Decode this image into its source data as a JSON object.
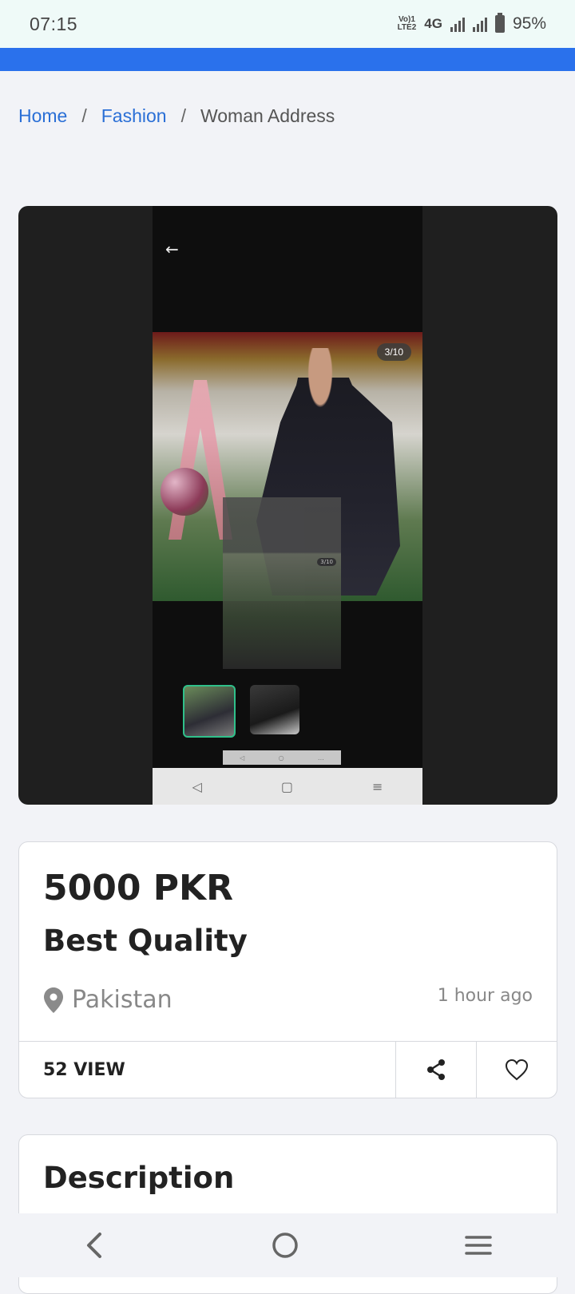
{
  "status_bar": {
    "time": "07:15",
    "lte_label": "Vo)) 1\nLTE2",
    "network": "4G",
    "battery": "95%"
  },
  "breadcrumb": {
    "home": "Home",
    "category": "Fashion",
    "separator": "/",
    "current": "Woman Address"
  },
  "gallery": {
    "counter": "3/10",
    "small_counter": "3/10",
    "thumbnail_count": 2,
    "active_thumbnail": 0
  },
  "listing": {
    "price": "5000 PKR",
    "title": "Best Quality",
    "location": "Pakistan",
    "posted": "1 hour ago",
    "views": "52 VIEW"
  },
  "description": {
    "heading": "Description"
  },
  "icons": {
    "location": "map-pin-icon",
    "share": "share-icon",
    "favorite": "heart-icon",
    "nav_back": "back-chevron-icon",
    "nav_home": "home-circle-icon",
    "nav_menu": "menu-lines-icon"
  },
  "colors": {
    "accent": "#2a71ec",
    "link": "#2a6fd6",
    "background": "#f2f3f7",
    "thumbnail_active_border": "#2fc08a"
  }
}
